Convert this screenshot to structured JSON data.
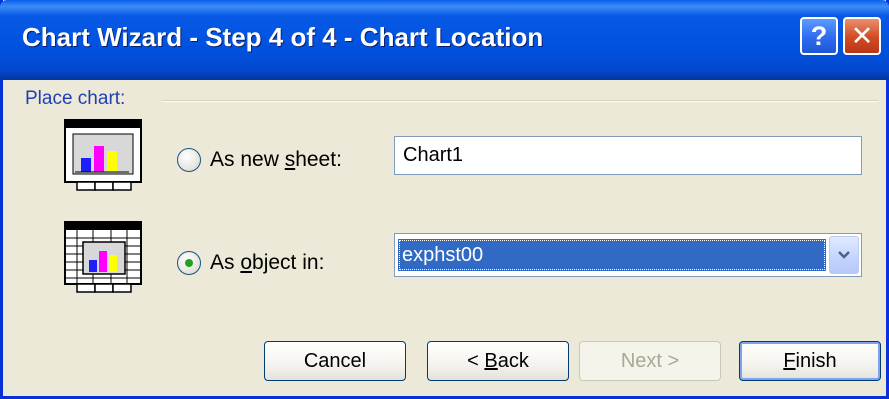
{
  "window": {
    "title": "Chart Wizard - Step 4 of 4 - Chart Location",
    "help_glyph": "?",
    "close_glyph": "✕"
  },
  "group": {
    "label": "Place chart:"
  },
  "options": {
    "new_sheet": {
      "label_pre": "As new ",
      "label_key": "s",
      "label_post": "heet:",
      "selected": false,
      "value": "Chart1"
    },
    "object_in": {
      "label_pre": "As ",
      "label_key": "o",
      "label_post": "bject in:",
      "selected": true,
      "value": "exphst00"
    }
  },
  "buttons": {
    "cancel": "Cancel",
    "back_pre": "< ",
    "back_key": "B",
    "back_post": "ack",
    "next": "Next >",
    "finish_key": "F",
    "finish_post": "inish"
  },
  "icons": {
    "new_sheet": "chart-sheet-icon",
    "object_in": "embedded-chart-icon",
    "dropdown": "chevron-down-icon"
  },
  "colors": {
    "bar_blue": "#1E1EFF",
    "bar_magenta": "#FF00FF",
    "bar_yellow": "#FFFF00",
    "selection": "#316AC5"
  }
}
